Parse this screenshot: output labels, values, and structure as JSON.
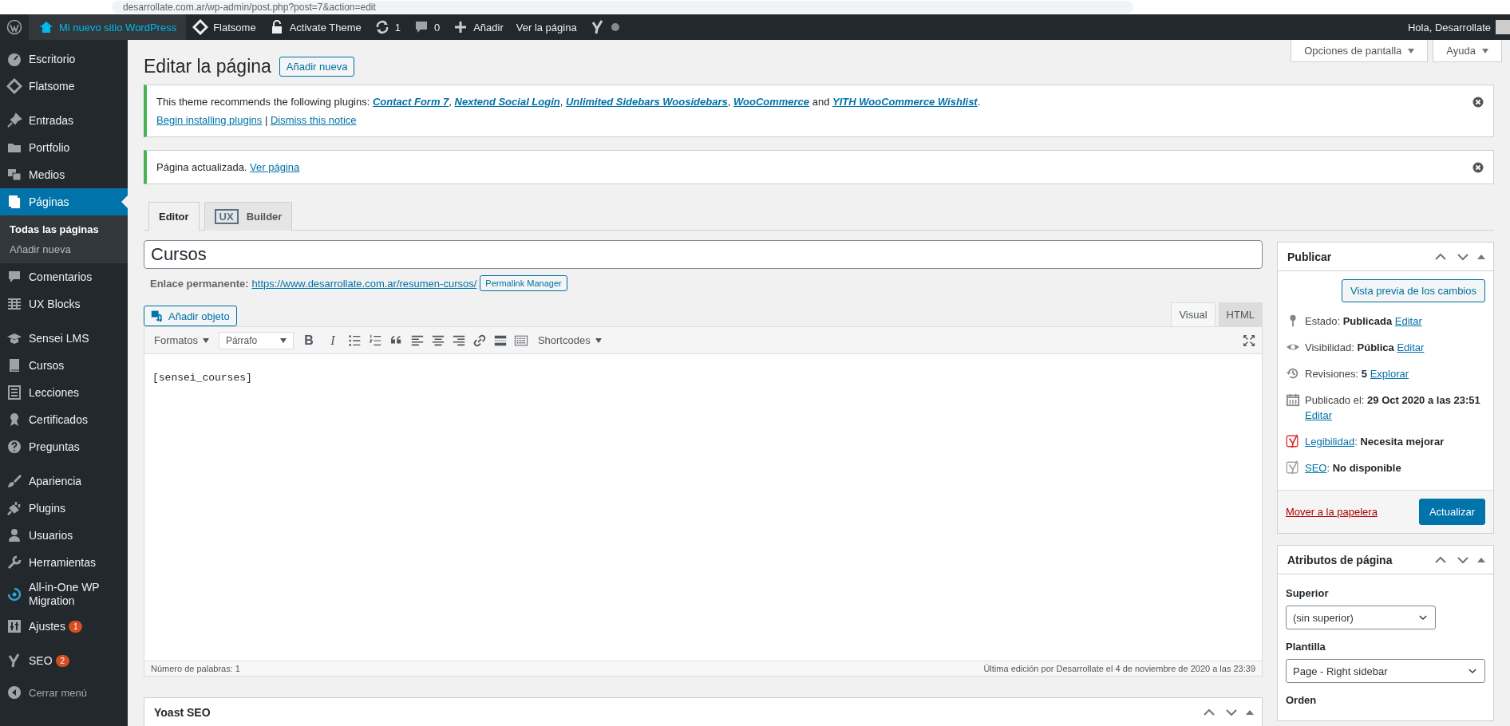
{
  "browser": {
    "url": "desarrollate.com.ar/wp-admin/post.php?post=7&action=edit"
  },
  "admin_bar": {
    "site_name": "Mi nuevo sitio WordPress",
    "items": [
      {
        "kind": "flatsome",
        "label": "Flatsome"
      },
      {
        "kind": "lock",
        "label": "Activate Theme"
      },
      {
        "kind": "updates",
        "label": "1"
      },
      {
        "kind": "comments",
        "label": "0"
      },
      {
        "kind": "new",
        "label": "Añadir"
      },
      {
        "kind": "plain",
        "label": "Ver la página"
      },
      {
        "kind": "yoast"
      }
    ],
    "greeting": "Hola, Desarrollate"
  },
  "sidebar": {
    "groups": [
      [
        {
          "label": "Escritorio",
          "selected": false
        },
        {
          "label": "Flatsome",
          "selected": false
        }
      ],
      [
        {
          "label": "Entradas",
          "selected": false
        },
        {
          "label": "Portfolio",
          "selected": false
        },
        {
          "label": "Medios",
          "selected": false
        },
        {
          "label": "Páginas",
          "selected": true,
          "children": [
            {
              "label": "Todas las páginas",
              "selected": true
            },
            {
              "label": "Añadir nueva",
              "selected": false
            }
          ]
        },
        {
          "label": "Comentarios",
          "selected": false
        },
        {
          "label": "UX Blocks",
          "selected": false
        }
      ],
      [
        {
          "label": "Sensei LMS",
          "selected": false
        },
        {
          "label": "Cursos",
          "selected": false
        },
        {
          "label": "Lecciones",
          "selected": false
        },
        {
          "label": "Certificados",
          "selected": false
        },
        {
          "label": "Preguntas",
          "selected": false
        }
      ],
      [
        {
          "label": "Apariencia",
          "selected": false
        },
        {
          "label": "Plugins",
          "selected": false
        },
        {
          "label": "Usuarios",
          "selected": false
        },
        {
          "label": "Herramientas",
          "selected": false
        },
        {
          "label": "All-in-One WP Migration",
          "selected": false
        },
        {
          "label": "Ajustes",
          "selected": false,
          "badge": "1"
        }
      ],
      [
        {
          "label": "SEO",
          "selected": false,
          "badge": "2"
        }
      ]
    ],
    "collapse_label": "Cerrar menú"
  },
  "screen_meta": [
    "Opciones de pantalla",
    "Ayuda"
  ],
  "header": {
    "title": "Editar la página",
    "add_new": "Añadir nueva"
  },
  "notices": [
    {
      "lines": [
        [
          {
            "text": "This theme recommends the following plugins: "
          },
          {
            "link": "Contact Form 7",
            "italic": true
          },
          {
            "text": ", "
          },
          {
            "link": "Nextend Social Login",
            "italic": true
          },
          {
            "text": ", "
          },
          {
            "link": "Unlimited Sidebars Woosidebars",
            "italic": true
          },
          {
            "text": ", "
          },
          {
            "link": "WooCommerce",
            "italic": true
          },
          {
            "text": " and "
          },
          {
            "link": "YITH WooCommerce Wishlist",
            "italic": true
          },
          {
            "text": "."
          }
        ],
        [
          {
            "link": "Begin installing plugins",
            "italic": false
          },
          {
            "text": " | "
          },
          {
            "link": "Dismiss this notice",
            "italic": false
          }
        ]
      ]
    },
    {
      "lines": [
        [
          {
            "text": "Página actualizada. "
          },
          {
            "link": "Ver página",
            "italic": false
          }
        ]
      ]
    }
  ],
  "editor_tabs": [
    {
      "label": "Editor",
      "selected": true
    },
    {
      "label": "Builder",
      "selected": false,
      "badge": "UX"
    }
  ],
  "post_title": "Cursos",
  "permalink": {
    "label": "Enlace permanente:",
    "url": "https://www.desarrollate.com.ar/resumen-cursos/",
    "button": "Permalink Manager"
  },
  "add_media": "Añadir objeto",
  "mode_tabs": [
    {
      "label": "Visual",
      "selected": true
    },
    {
      "label": "HTML",
      "selected": false
    }
  ],
  "toolbar": [
    {
      "kind": "dropdown",
      "label": "Formatos"
    },
    {
      "kind": "select",
      "label": "Párrafo"
    },
    {
      "kind": "glyph",
      "label": "B"
    },
    {
      "kind": "glyph",
      "label": "I"
    },
    {
      "kind": "icon"
    },
    {
      "kind": "icon"
    },
    {
      "kind": "icon"
    },
    {
      "kind": "icon"
    },
    {
      "kind": "icon"
    },
    {
      "kind": "icon"
    },
    {
      "kind": "icon"
    },
    {
      "kind": "icon"
    },
    {
      "kind": "icon"
    },
    {
      "kind": "dropdown",
      "label": "Shortcodes"
    }
  ],
  "content": "[sensei_courses]",
  "status": {
    "word_count": "Número de palabras: 1",
    "last_edit": "Última edición por Desarrollate el 4 de noviembre de 2020 a las 23:39"
  },
  "yoast_box": {
    "title": "Yoast SEO"
  },
  "publish": {
    "title": "Publicar",
    "preview": "Vista previa de los cambios",
    "rows": [
      {
        "kind": "meta",
        "label": "Estado: ",
        "value": "Publicada",
        "link": "Editar"
      },
      {
        "kind": "meta",
        "label": "Visibilidad: ",
        "value": "Pública",
        "link": "Editar"
      },
      {
        "kind": "meta",
        "label": "Revisiones: ",
        "value": "5",
        "link": "Explorar"
      },
      {
        "kind": "meta",
        "label": "Publicado el: ",
        "value": "29 Oct 2020 a las 23:51",
        "link": "Editar"
      },
      {
        "kind": "score",
        "link": "Legibilidad",
        "label": ": ",
        "value": "Necesita mejorar",
        "color": "#dc3232"
      },
      {
        "kind": "score",
        "link": "SEO",
        "label": ": ",
        "value": "No disponible",
        "color": "#a0a5aa"
      }
    ],
    "trash": "Mover a la papelera",
    "update": "Actualizar"
  },
  "page_attributes": {
    "title": "Atributos de página",
    "parent_label": "Superior",
    "parent_value": "(sin superior)",
    "template_label": "Plantilla",
    "template_value": "Page - Right sidebar",
    "order_label": "Orden"
  }
}
